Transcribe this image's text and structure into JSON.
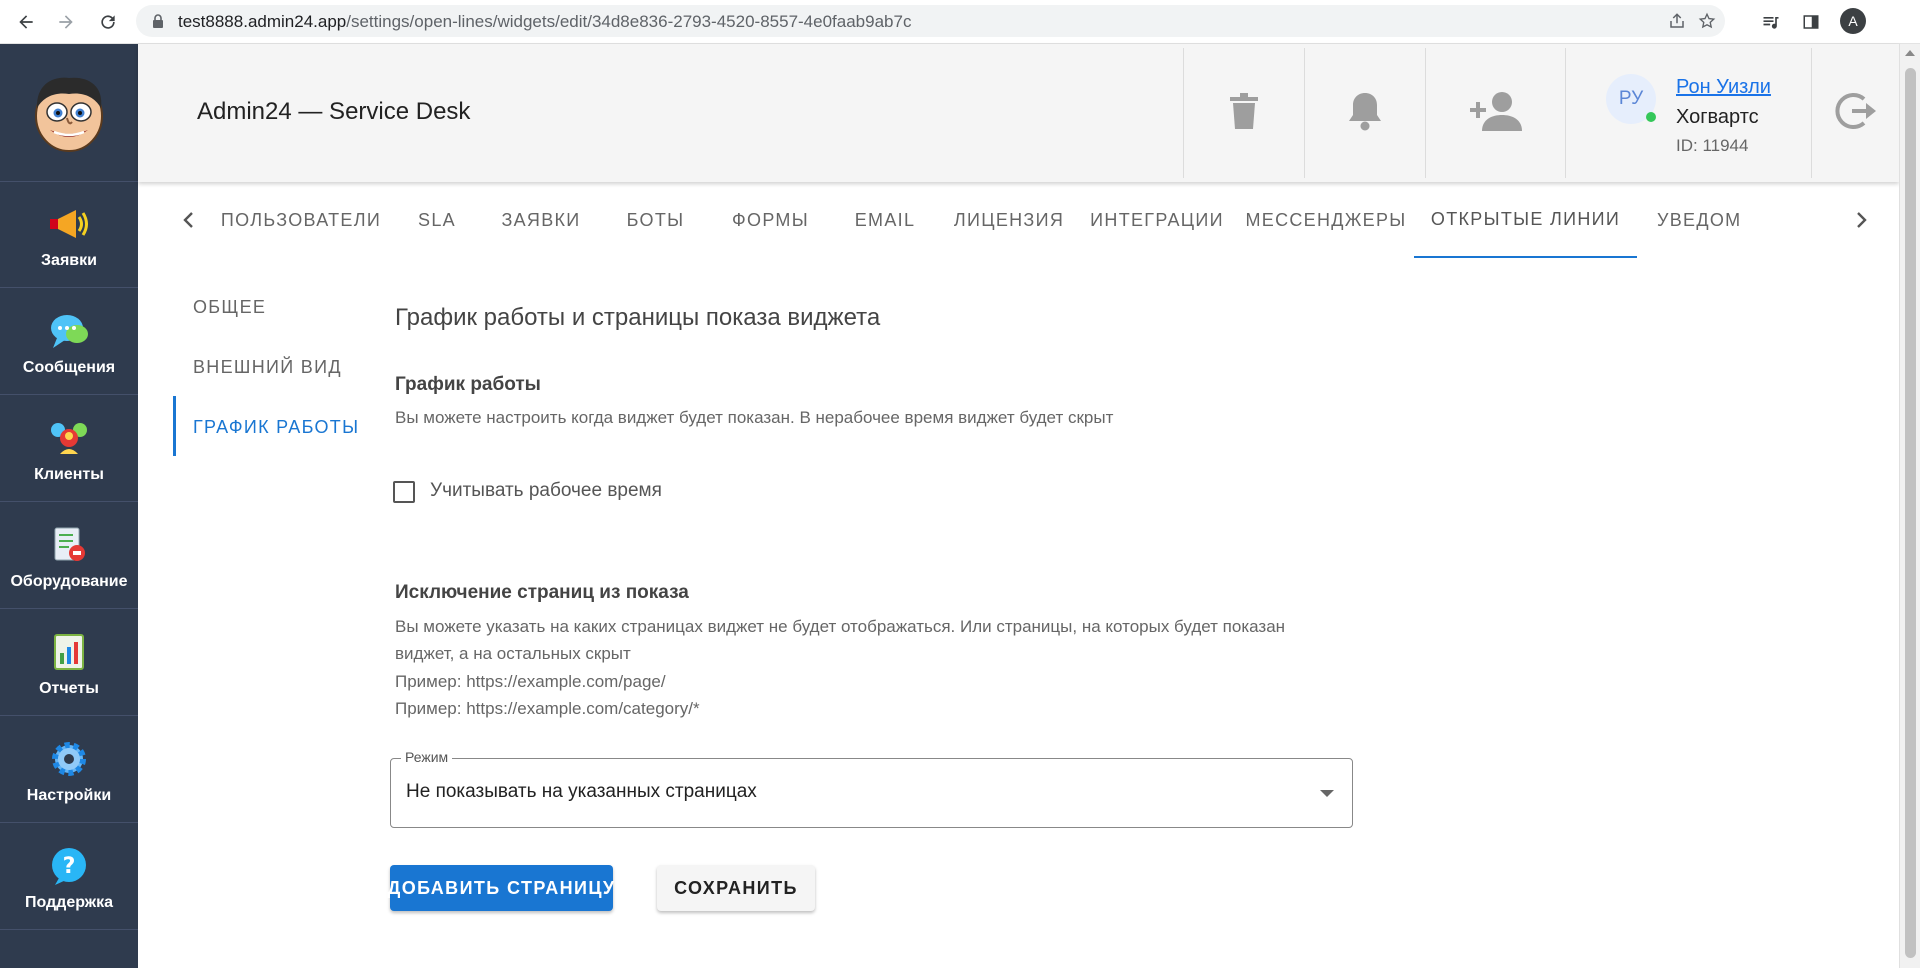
{
  "browser": {
    "url_host": "test8888.admin24.app",
    "url_path": "/settings/open-lines/widgets/edit/34d8e836-2793-4520-8557-4e0faab9ab7c",
    "profile_initial": "A"
  },
  "sidebar": {
    "items": [
      {
        "label": "Заявки",
        "icon": "megaphone-icon"
      },
      {
        "label": "Сообщения",
        "icon": "chat-bubbles-icon"
      },
      {
        "label": "Клиенты",
        "icon": "clients-icon"
      },
      {
        "label": "Оборудование",
        "icon": "equipment-icon"
      },
      {
        "label": "Отчеты",
        "icon": "reports-icon"
      },
      {
        "label": "Настройки",
        "icon": "gear-icon"
      },
      {
        "label": "Поддержка",
        "icon": "help-icon"
      }
    ]
  },
  "header": {
    "title": "Admin24 — Service Desk",
    "user": {
      "initials": "РУ",
      "name": "Рон Уизли",
      "org": "Хогвартс",
      "id": "ID: 11944"
    }
  },
  "tabs": [
    {
      "label": "ПОЛЬЗОВАТЕЛИ"
    },
    {
      "label": "SLA"
    },
    {
      "label": "ЗАЯВКИ"
    },
    {
      "label": "БОТЫ"
    },
    {
      "label": "ФОРМЫ"
    },
    {
      "label": "EMAIL"
    },
    {
      "label": "ЛИЦЕНЗИЯ"
    },
    {
      "label": "ИНТЕГРАЦИИ"
    },
    {
      "label": "МЕССЕНДЖЕРЫ"
    },
    {
      "label": "ОТКРЫТЫЕ ЛИНИИ",
      "active": true
    },
    {
      "label": "УВЕДОМ"
    }
  ],
  "subnav": [
    {
      "label": "ОБЩЕЕ"
    },
    {
      "label": "ВНЕШНИЙ ВИД"
    },
    {
      "label": "ГРАФИК РАБОТЫ",
      "active": true
    }
  ],
  "main": {
    "title": "График работы и страницы показа виджета",
    "schedule": {
      "heading": "График работы",
      "description": "Вы можете настроить когда виджет будет показан. В нерабочее время виджет будет скрыт",
      "checkbox_label": "Учитывать рабочее время",
      "checkbox_checked": false
    },
    "exclusion": {
      "heading": "Исключение страниц из показа",
      "description_line1": "Вы можете указать на каких страницах виджет не будет отображаться. Или страницы, на которых будет показан",
      "description_line2": "виджет, а на остальных скрыт",
      "example1": "Пример: https://example.com/page/",
      "example2": "Пример: https://example.com/category/*"
    },
    "mode": {
      "label": "Режим",
      "value": "Не показывать на указанных страницах"
    },
    "buttons": {
      "add_page": "ДОБАВИТЬ СТРАНИЦУ",
      "save": "СОХРАНИТЬ"
    }
  },
  "colors": {
    "accent": "#1976d2",
    "sidebar_bg": "#2f3b4e",
    "header_bg": "#f5f5f5",
    "online": "#34c759"
  }
}
